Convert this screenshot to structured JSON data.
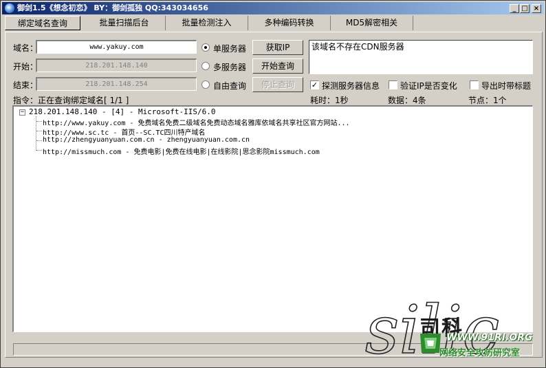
{
  "window": {
    "title": "御剑1.5《想念初恋》  BY：御剑孤独 QQ:343034656",
    "controls": {
      "minimize": "_",
      "maximize": "□",
      "close": "×"
    }
  },
  "tabs": [
    {
      "label": "绑定域名查询",
      "active": true
    },
    {
      "label": "批量扫描后台",
      "active": false
    },
    {
      "label": "批量检测注入",
      "active": false
    },
    {
      "label": "多种编码转换",
      "active": false
    },
    {
      "label": "MD5解密相关",
      "active": false
    }
  ],
  "form": {
    "domain_label": "域名：",
    "domain_value": "www.yakuy.com",
    "start_label": "开始：",
    "start_value": "218.201.148.140",
    "end_label": "结束：",
    "end_value": "218.201.148.254",
    "radio_single": "单服务器",
    "radio_multi": "多服务器",
    "radio_free": "自由查询",
    "radio_selected": "单服务器",
    "btn_getip": "获取IP",
    "btn_start": "开始查询",
    "btn_stop": "停止查询"
  },
  "result_text": "该域名不存在CDN服务器",
  "options": {
    "detect_server": {
      "label": "探测服务器信息",
      "checked": true
    },
    "verify_ip": {
      "label": "验证IP是否变化",
      "checked": false
    },
    "export_title": {
      "label": "导出时带标题",
      "checked": false
    }
  },
  "statusline": {
    "command": "指令：正在查询绑定域名[ 1/1 ]",
    "elapsed": "耗时：1秒",
    "count": "数据：4条",
    "nodes": "节点：1个"
  },
  "tree": {
    "expander": "−",
    "root": "218.201.148.140 - [4] - Microsoft-IIS/6.0",
    "children": [
      "http://www.yakuy.com - 免费域名免费二级域名免费动态域名雅库依域名共享社区官方网站...",
      "http://www.sc.tc - 首页--SC.TC四川特产域名",
      "http://zhengyuanyuan.com.cn - zhengyuanyuan.com.cn",
      "http://missmuch.com - 免费电影|免费在线电影|在线影院|思念影院missmuch.com"
    ]
  },
  "watermark": {
    "script_text": "silic",
    "cn_text": "司科",
    "site": "WWW.91RI.ORG",
    "org": "网络安全攻防研究室"
  },
  "colors": {
    "titlebar_start": "#0a246a",
    "titlebar_end": "#a6caf0",
    "face": "#d4d0c8",
    "watermark_green": "#2e8b2e"
  }
}
